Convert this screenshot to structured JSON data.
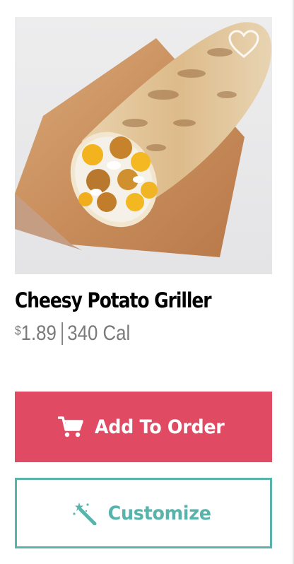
{
  "product": {
    "name": "Cheesy Potato Griller",
    "price_currency": "$",
    "price_amount": "1.89",
    "calories": "340 Cal"
  },
  "actions": {
    "add_to_order_label": "Add To Order",
    "customize_label": "Customize"
  },
  "icons": {
    "favorite": "heart-outline-icon",
    "cart": "cart-icon",
    "customize": "magic-wand-icon"
  },
  "colors": {
    "add_button_bg": "#e04a63",
    "customize_accent": "#58b3ab",
    "title": "#000000",
    "meta_text": "#7a7a7a"
  }
}
